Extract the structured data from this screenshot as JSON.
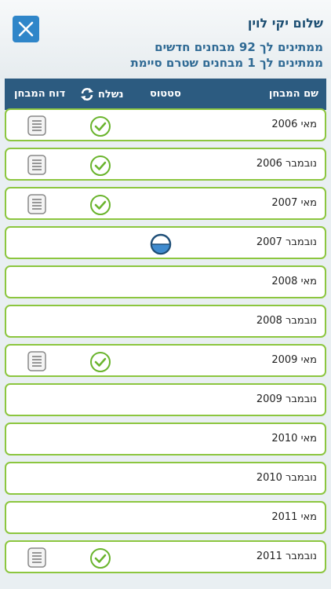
{
  "header": {
    "greeting": "שלום יקי לוין",
    "info_line_1": "ממתינים לך 92 מבחנים חדשים",
    "info_line_2": "ממתינים לך 1 מבחנים שטרם סיימת"
  },
  "table": {
    "columns": {
      "name": "שם המבחן",
      "status": "סטטוס",
      "sent": "נשלח",
      "report": "דוח המבחן"
    },
    "rows": [
      {
        "label": "מאי 2006",
        "sent": true,
        "report": true,
        "status": ""
      },
      {
        "label": "נובמבר 2006",
        "sent": true,
        "report": true,
        "status": ""
      },
      {
        "label": "מאי 2007",
        "sent": true,
        "report": true,
        "status": ""
      },
      {
        "label": "נובמבר 2007",
        "sent": false,
        "report": false,
        "status": "in-progress"
      },
      {
        "label": "מאי 2008",
        "sent": false,
        "report": false,
        "status": ""
      },
      {
        "label": "נובמבר 2008",
        "sent": false,
        "report": false,
        "status": ""
      },
      {
        "label": "מאי 2009",
        "sent": true,
        "report": true,
        "status": ""
      },
      {
        "label": "נובמבר 2009",
        "sent": false,
        "report": false,
        "status": ""
      },
      {
        "label": "מאי 2010",
        "sent": false,
        "report": false,
        "status": ""
      },
      {
        "label": "נובמבר 2010",
        "sent": false,
        "report": false,
        "status": ""
      },
      {
        "label": "מאי 2011",
        "sent": false,
        "report": false,
        "status": ""
      },
      {
        "label": "נובמבר 2011",
        "sent": true,
        "report": true,
        "status": ""
      }
    ]
  },
  "colors": {
    "accent": "#2f86c9",
    "header_bar": "#2c5b80",
    "row_border": "#8cc63f",
    "check": "#6ab42d"
  },
  "icons": {
    "close": "close-icon",
    "refresh": "refresh-icon",
    "check": "check-circle-icon",
    "report": "document-icon",
    "status": "half-circle-icon"
  }
}
